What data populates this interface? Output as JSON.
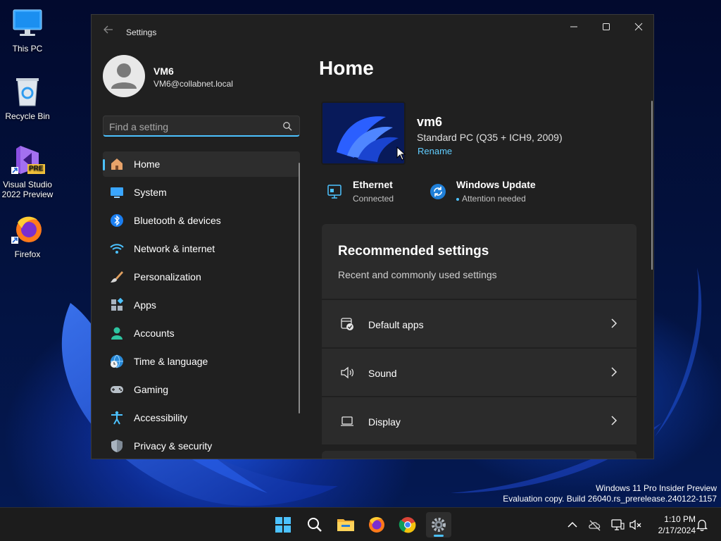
{
  "desktop": {
    "icons": [
      {
        "label": "This PC"
      },
      {
        "label": "Recycle Bin"
      },
      {
        "label": "Visual Studio 2022 Preview",
        "badge": "PRE"
      },
      {
        "label": "Firefox"
      }
    ],
    "watermark": {
      "line1": "Windows 11 Pro Insider Preview",
      "line2": "Evaluation copy. Build 26040.rs_prerelease.240122-1157"
    }
  },
  "window": {
    "title": "Settings",
    "controls": {
      "minimize": "—",
      "maximize": "☐",
      "close": "✕"
    }
  },
  "profile": {
    "name": "VM6",
    "email": "VM6@collabnet.local"
  },
  "search": {
    "placeholder": "Find a setting",
    "value": ""
  },
  "nav": {
    "items": [
      {
        "label": "Home",
        "icon": "home-icon",
        "active": true
      },
      {
        "label": "System",
        "icon": "system-icon"
      },
      {
        "label": "Bluetooth & devices",
        "icon": "bluetooth-icon"
      },
      {
        "label": "Network & internet",
        "icon": "wifi-icon"
      },
      {
        "label": "Personalization",
        "icon": "brush-icon"
      },
      {
        "label": "Apps",
        "icon": "apps-icon"
      },
      {
        "label": "Accounts",
        "icon": "accounts-icon"
      },
      {
        "label": "Time & language",
        "icon": "globe-clock-icon"
      },
      {
        "label": "Gaming",
        "icon": "gamepad-icon"
      },
      {
        "label": "Accessibility",
        "icon": "accessibility-icon"
      },
      {
        "label": "Privacy & security",
        "icon": "shield-icon"
      }
    ]
  },
  "main": {
    "title": "Home",
    "device": {
      "name": "vm6",
      "model": "Standard PC (Q35 + ICH9, 2009)",
      "rename": "Rename"
    },
    "status": {
      "ethernet": {
        "title": "Ethernet",
        "sub": "Connected"
      },
      "update": {
        "title": "Windows Update",
        "sub": "Attention needed"
      }
    },
    "recommended": {
      "title": "Recommended settings",
      "subtitle": "Recent and commonly used settings",
      "rows": [
        {
          "label": "Default apps",
          "icon": "default-apps-icon"
        },
        {
          "label": "Sound",
          "icon": "speaker-icon"
        },
        {
          "label": "Display",
          "icon": "laptop-icon"
        }
      ]
    }
  },
  "taskbar": {
    "apps": [
      "start-icon",
      "search-icon",
      "file-explorer-icon",
      "firefox-icon",
      "chrome-icon",
      "settings-icon"
    ],
    "active_app": "settings-icon",
    "time": "1:10 PM",
    "date": "2/17/2024"
  },
  "colors": {
    "accent": "#4cc2ff",
    "link": "#60cdff",
    "window_bg": "#202020",
    "card_bg": "#2b2b2b"
  }
}
